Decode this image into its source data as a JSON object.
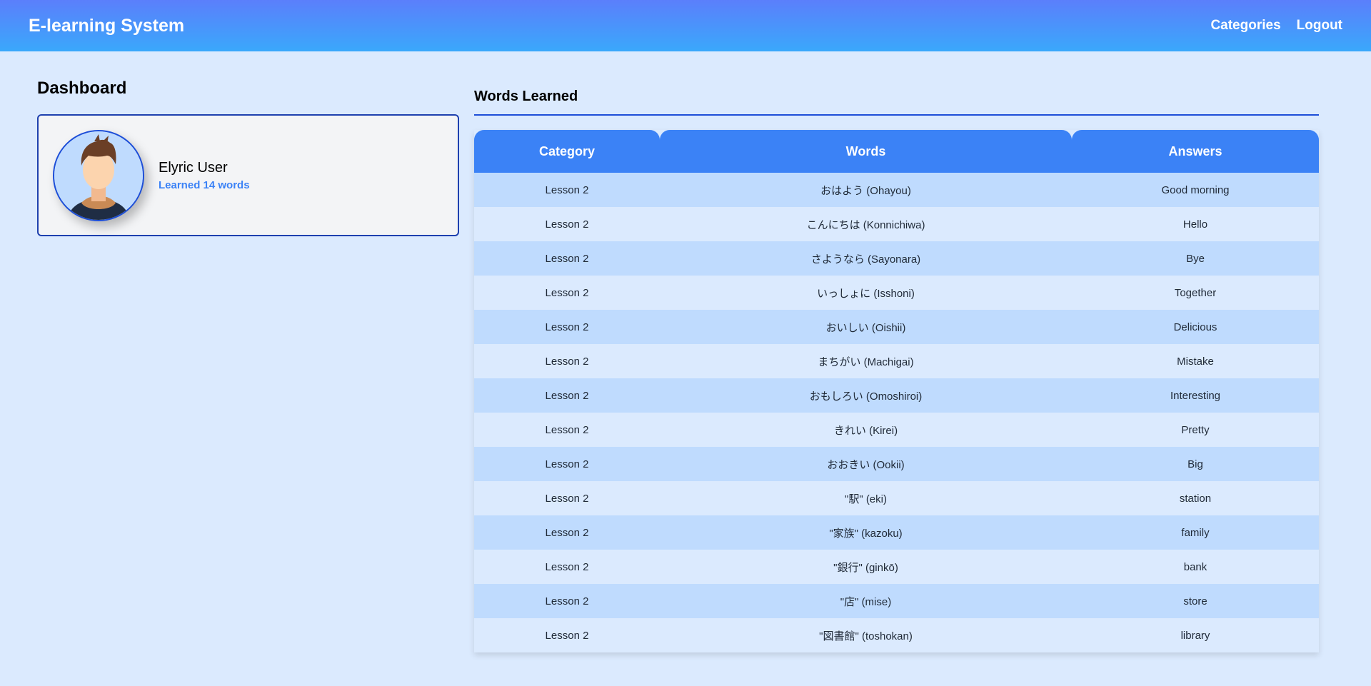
{
  "navbar": {
    "brand": "E-learning System",
    "links": [
      "Categories",
      "Logout"
    ]
  },
  "dashboard": {
    "title": "Dashboard",
    "user_name": "Elyric User",
    "learned_text": "Learned 14 words"
  },
  "words": {
    "title": "Words Learned",
    "headers": [
      "Category",
      "Words",
      "Answers"
    ],
    "rows": [
      [
        "Lesson 2",
        "おはよう (Ohayou)",
        "Good morning"
      ],
      [
        "Lesson 2",
        "こんにちは (Konnichiwa)",
        "Hello"
      ],
      [
        "Lesson 2",
        "さようなら (Sayonara)",
        "Bye"
      ],
      [
        "Lesson 2",
        "いっしょに (Isshoni)",
        "Together"
      ],
      [
        "Lesson 2",
        "おいしい (Oishii)",
        "Delicious"
      ],
      [
        "Lesson 2",
        "まちがい (Machigai)",
        "Mistake"
      ],
      [
        "Lesson 2",
        "おもしろい (Omoshiroi)",
        "Interesting"
      ],
      [
        "Lesson 2",
        "きれい (Kirei)",
        "Pretty"
      ],
      [
        "Lesson 2",
        "おおきい (Ookii)",
        "Big"
      ],
      [
        "Lesson 2",
        "\"駅\" (eki)",
        "station"
      ],
      [
        "Lesson 2",
        "\"家族\" (kazoku)",
        "family"
      ],
      [
        "Lesson 2",
        "\"銀行\" (ginkō)",
        "bank"
      ],
      [
        "Lesson 2",
        "\"店\" (mise)",
        "store"
      ],
      [
        "Lesson 2",
        "\"図書館\" (toshokan)",
        "library"
      ]
    ]
  },
  "colors": {
    "nav_gradient_top": "#5b7ffb",
    "nav_gradient_bottom": "#3aa8fb",
    "page_bg": "#dbeafe",
    "table_header": "#3b82f6",
    "row_odd": "#bfdbfe",
    "row_even": "#dbeafe",
    "accent_border": "#1d4ed8"
  }
}
